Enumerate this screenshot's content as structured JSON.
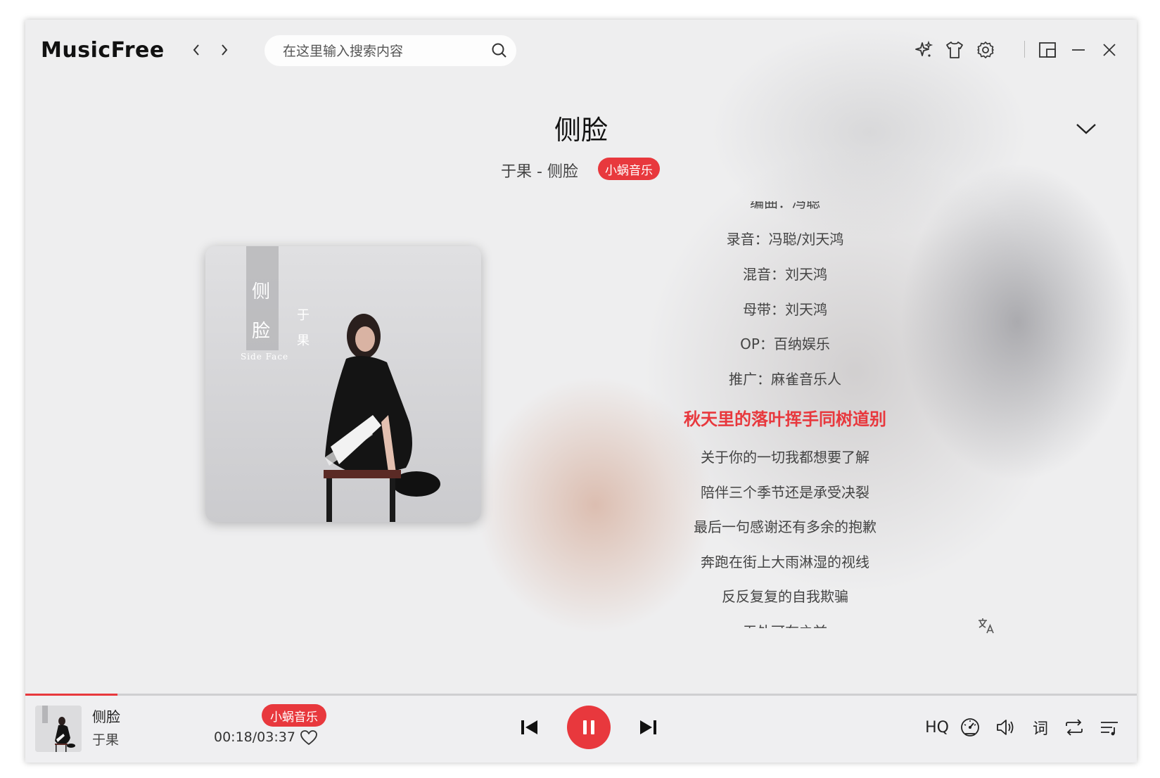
{
  "app": {
    "name": "MusicFree"
  },
  "header": {
    "search_placeholder": "在这里输入搜索内容",
    "back_icon": "chevron-left-icon",
    "forward_icon": "chevron-right-icon",
    "right_icons": [
      "sparkle-icon",
      "tshirt-icon",
      "gear-icon",
      "mini-window-icon",
      "minimize-icon",
      "close-icon"
    ]
  },
  "song": {
    "title": "侧脸",
    "subtitle": "于果 - 侧脸",
    "source_badge": "小蜗音乐"
  },
  "album_art": {
    "title_chars": [
      "侧",
      "脸"
    ],
    "artist_chars": [
      "于",
      "果"
    ],
    "english_title": "Side Face"
  },
  "lyrics": {
    "partial_top": "编曲：冯聪",
    "lines": [
      "录音：冯聪/刘天鸿",
      "混音：刘天鸿",
      "母带：刘天鸿",
      "OP：百纳娱乐",
      "推广：麻雀音乐人"
    ],
    "active": "秋天里的落叶挥手同树道别",
    "after": [
      "关于你的一切我都想要了解",
      "陪伴三个季节还是承受决裂",
      "最后一句感谢还有多余的抱歉",
      "奔跑在街上大雨淋湿的视线",
      "反反复复的自我欺骗"
    ],
    "partial_bottom": "无处可在之前"
  },
  "player": {
    "title": "侧脸",
    "artist": "于果",
    "source_badge": "小蜗音乐",
    "time": "00:18/03:37",
    "progress": 0.083,
    "quality": "HQ",
    "lyric_toggle": "词",
    "accent_color": "#e8383d"
  }
}
